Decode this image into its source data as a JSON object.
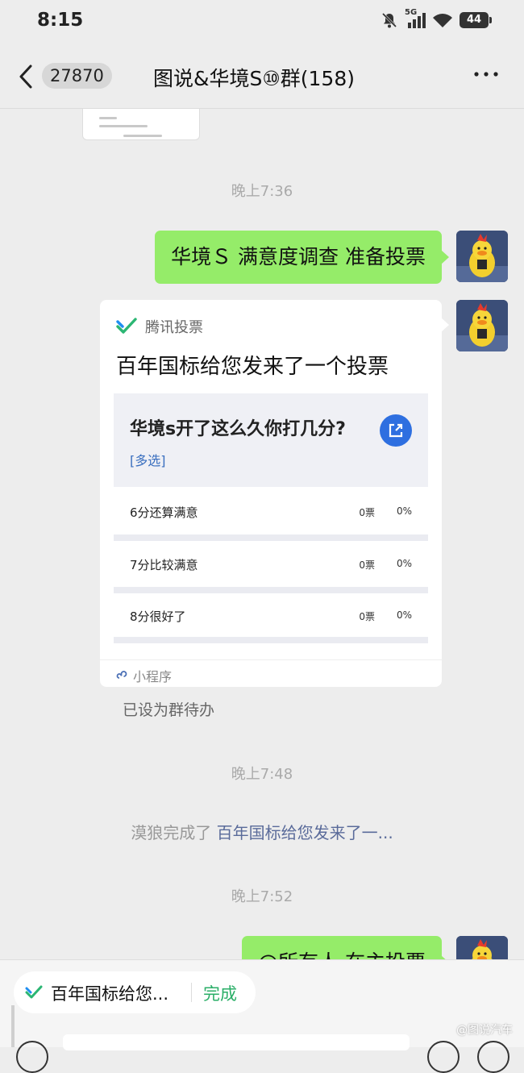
{
  "status_bar": {
    "time": "8:15",
    "network": "5G",
    "battery": "44"
  },
  "header": {
    "unread_count": "27870",
    "title": "图说&华境S⑩群(158)"
  },
  "messages": {
    "time1": "晚上7:36",
    "text1": "华境Ｓ 满意度调查 准备投票",
    "card": {
      "app_name": "腾讯投票",
      "title": "百年国标给您发来了一个投票",
      "question": "华境s开了这么久你打几分?",
      "type": "[多选]",
      "options": [
        {
          "label": "6分还算满意",
          "votes": "0票",
          "percent": "0%"
        },
        {
          "label": "7分比较满意",
          "votes": "0票",
          "percent": "0%"
        },
        {
          "label": "8分很好了",
          "votes": "0票",
          "percent": "0%"
        }
      ],
      "footer": "小程序"
    },
    "todo_note": "已设为群待办",
    "time2": "晚上7:48",
    "system_prefix": "漠狼完成了",
    "system_link": "百年国标给您发来了一...",
    "time3": "晚上7:52",
    "text2": "@所有人 在主投票"
  },
  "bottom": {
    "pill_text": "百年国标给您...",
    "pill_action": "完成"
  },
  "watermark": "@图说汽车",
  "colors": {
    "bubble_green": "#95ec69",
    "done_green": "#2aae67",
    "share_blue": "#2e6fe0"
  }
}
